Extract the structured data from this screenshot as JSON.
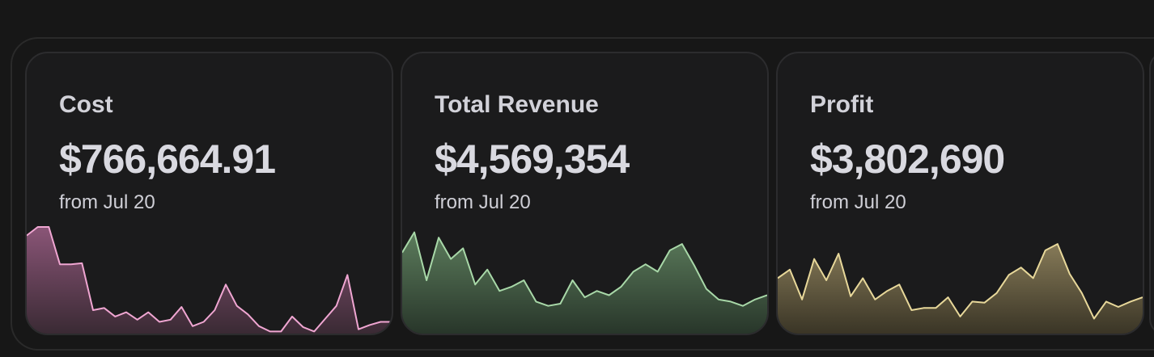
{
  "cards": [
    {
      "label": "Cost",
      "value": "$766,664.91",
      "sub": "from Jul 20",
      "line_color": "#f0a6d2",
      "fill_top": "#8a5577",
      "fill_bottom": "#3a2a34",
      "chart_data": {
        "type": "area",
        "values": [
          92,
          100,
          100,
          65,
          65,
          66,
          22,
          24,
          16,
          20,
          13,
          20,
          11,
          13,
          25,
          7,
          11,
          22,
          46,
          26,
          18,
          7,
          2,
          2,
          16,
          6,
          2,
          14,
          26,
          55,
          4,
          8,
          11,
          11
        ]
      }
    },
    {
      "label": "Total Revenue",
      "value": "$4,569,354",
      "sub": "from Jul 20",
      "line_color": "#a8d8a8",
      "fill_top": "#5c7c5c",
      "fill_bottom": "#28362a",
      "chart_data": {
        "type": "area",
        "values": [
          76,
          95,
          50,
          90,
          70,
          80,
          46,
          60,
          40,
          44,
          50,
          30,
          26,
          28,
          50,
          34,
          40,
          36,
          44,
          58,
          65,
          58,
          78,
          84,
          64,
          42,
          32,
          30,
          26,
          32,
          36
        ]
      }
    },
    {
      "label": "Profit",
      "value": "$3,802,690",
      "sub": "from Jul 20",
      "line_color": "#e8d89a",
      "fill_top": "#867a58",
      "fill_bottom": "#3a3526",
      "chart_data": {
        "type": "area",
        "values": [
          52,
          60,
          32,
          70,
          50,
          75,
          35,
          52,
          32,
          40,
          46,
          22,
          24,
          24,
          34,
          16,
          30,
          29,
          38,
          55,
          62,
          52,
          78,
          84,
          56,
          38,
          14,
          30,
          25,
          30,
          34
        ]
      }
    }
  ]
}
